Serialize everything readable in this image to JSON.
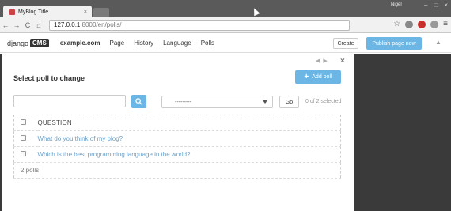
{
  "browser": {
    "tab_title": "MyBlog Title",
    "tab_close": "×",
    "user_name": "Nigel",
    "window_controls": [
      "–",
      "□",
      "×"
    ],
    "url_host": "127.0.0.1",
    "url_path": ":8000/en/polls/",
    "nav_back": "←",
    "nav_forward": "→",
    "nav_reload": "C",
    "nav_home": "⌂",
    "star": "☆",
    "menu": "≡"
  },
  "cms_toolbar": {
    "logo_text": "django",
    "logo_badge": "CMS",
    "site": "example.com",
    "menu_items": [
      "Page",
      "History",
      "Language",
      "Polls"
    ],
    "create_label": "Create",
    "publish_label": "Publish page now",
    "caret": "▲",
    "accent_color": "#6cb6e5"
  },
  "modal": {
    "title": "Select poll to change",
    "add_label": "Add poll",
    "add_icon": "+",
    "close": "×",
    "prev": "◀",
    "next": "▶",
    "search": {
      "value": "",
      "placeholder": ""
    },
    "action_select": {
      "selected": "---------"
    },
    "go_label": "Go",
    "selected_count": "0 of 2 selected",
    "table": {
      "header": "QUESTION",
      "rows": [
        "What do you think of my blog?",
        "Which is the best programming language in the world?"
      ],
      "footer": "2 polls"
    }
  }
}
